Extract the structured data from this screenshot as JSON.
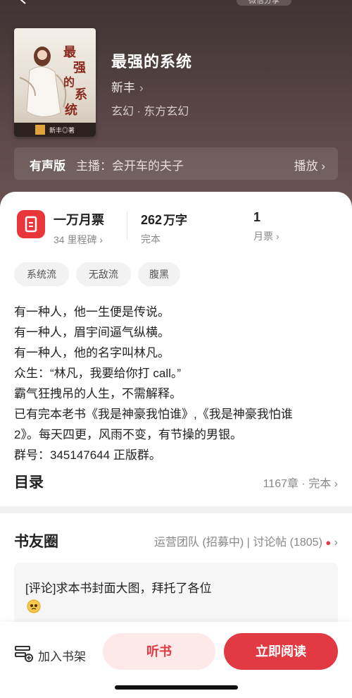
{
  "header": {
    "share_label": "微信分享"
  },
  "book": {
    "title": "最强的系统",
    "author": "新丰",
    "genre": "玄幻 · 东方玄幻",
    "cover": {
      "title_text": "最强的系统",
      "author_mark": "新丰◎著",
      "accent": "#8b2a1e"
    }
  },
  "audio": {
    "label": "有声版",
    "anchor": "主播：会开车的夫子",
    "play": "播放"
  },
  "stats": {
    "tickets": {
      "value": "一万月票",
      "sub": "34 里程碑"
    },
    "words": {
      "value": "262",
      "unit": "万字",
      "sub": "完本"
    },
    "monthly": {
      "value": "1",
      "sub": "月票"
    }
  },
  "tags": [
    "系统流",
    "无敌流",
    "腹黑"
  ],
  "description": [
    "有一种人，他一生便是传说。",
    "有一种人，眉宇间逼气纵横。",
    "有一种人，他的名字叫林凡。",
    "众生：“林凡，我要给你打 call。”",
    "霸气狂拽吊的人生，不需解释。",
    "已有完本老书《我是神豪我怕谁》,《我是神豪我怕谁",
    "2》。每天四更，风雨不变，有节操的男银。",
    "群号：345147644 正版群。"
  ],
  "toc": {
    "title": "目录",
    "meta": "1167章 · 完本"
  },
  "community": {
    "title": "书友圈",
    "meta": "运营团队 (招募中) | 讨论帖 (1805)",
    "post": {
      "text": "[评论]求本书封面大图，拜托了各位"
    }
  },
  "bottom": {
    "shelf": "加入书架",
    "listen": "听书",
    "read": "立即阅读"
  },
  "colors": {
    "accent": "#e23a42",
    "hero": "#4e3d3d",
    "ticket": "#e9363a"
  }
}
